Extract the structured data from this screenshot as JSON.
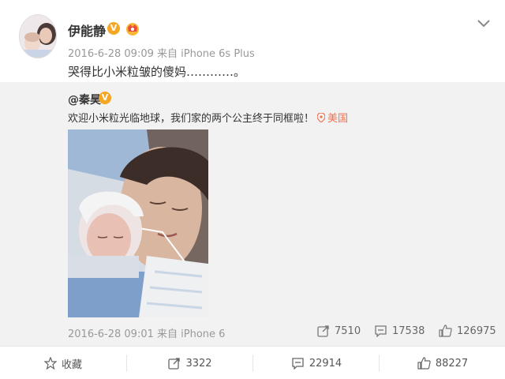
{
  "post": {
    "author": "伊能静",
    "meta": "2016-6-28 09:09  来自 iPhone 6s Plus",
    "text": "哭得比小米粒皱的傻妈…………。"
  },
  "repost": {
    "author": "@秦昊",
    "text": "欢迎小米粒光临地球，我们家的两个公主终于同框啦！",
    "location": "美国",
    "meta": "2016-6-28 09:01  来自 iPhone 6",
    "stats": {
      "reposts": "7510",
      "comments": "17538",
      "likes": "126975"
    }
  },
  "footer": {
    "favorite_label": "收藏",
    "repost_count": "3322",
    "comment_count": "22914",
    "like_count": "88227"
  },
  "colors": {
    "verified_badge": "#f5a623",
    "location": "#eb7350",
    "repost_bg": "#f2f2f2"
  },
  "icons": [
    "chevron-down-icon",
    "verified-icon",
    "crown-icon",
    "location-pin-icon",
    "repost-icon",
    "comment-icon",
    "like-icon",
    "star-icon"
  ]
}
